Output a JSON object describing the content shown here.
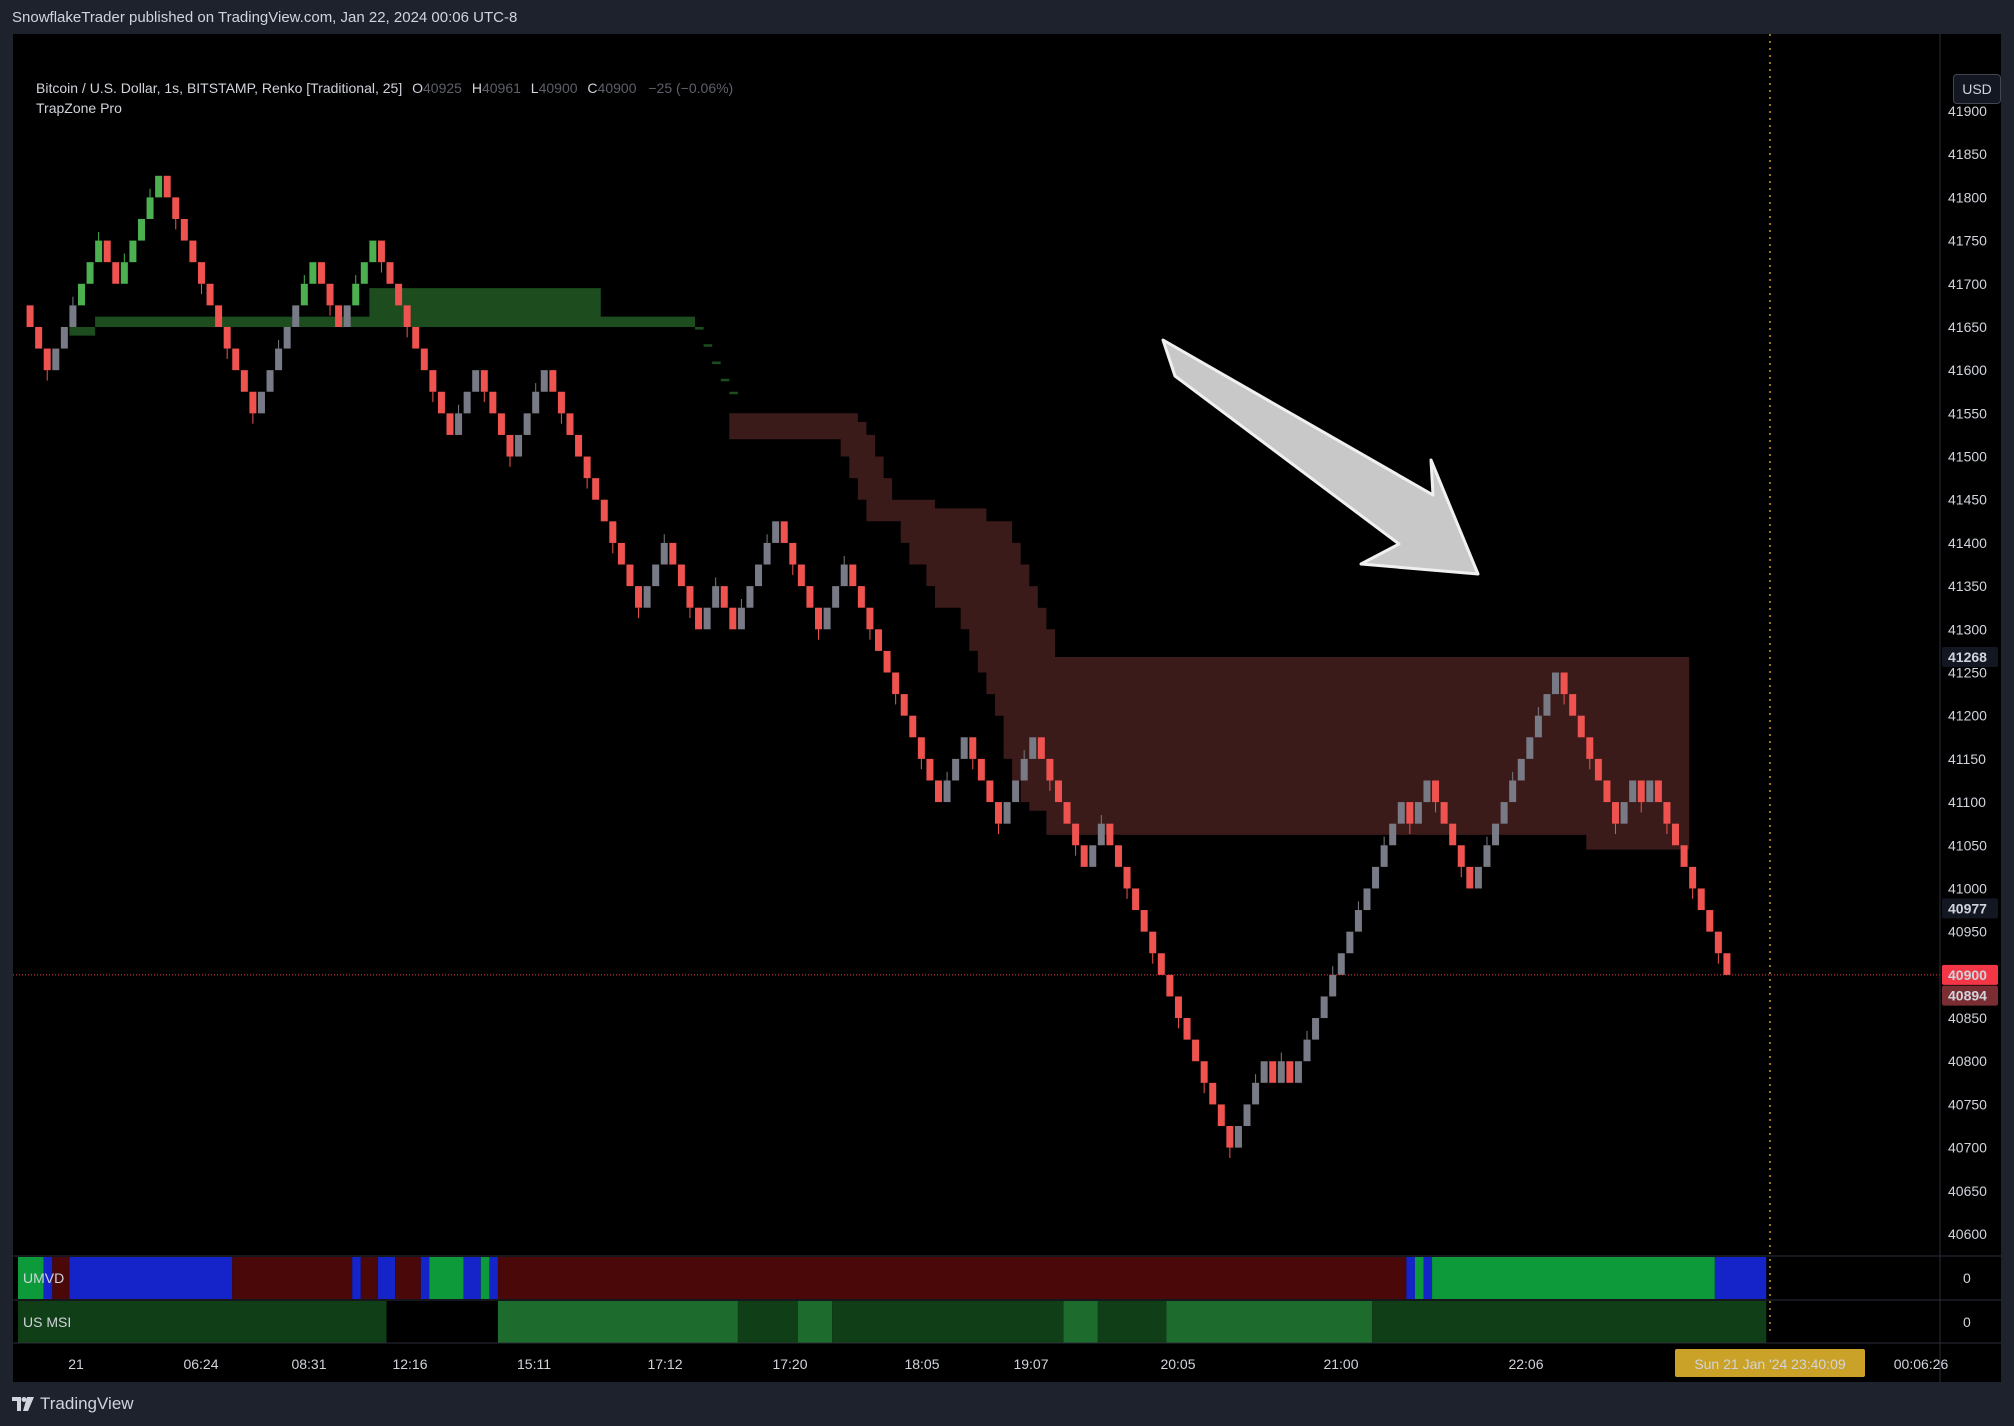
{
  "header": {
    "published": "SnowflakeTrader published on TradingView.com, Jan 22, 2024 00:06 UTC-8"
  },
  "legend": {
    "symbol": "Bitcoin / U.S. Dollar, 1s, BITSTAMP, Renko [Traditional, 25]",
    "o_label": "O",
    "o_value": "40925",
    "h_label": "H",
    "h_value": "40961",
    "l_label": "L",
    "l_value": "40900",
    "c_label": "C",
    "c_value": "40900",
    "change": "−25 (−0.06%)",
    "indicator": "TrapZone Pro"
  },
  "currency_button": "USD",
  "panels": {
    "umvd_label": "UMVD",
    "umvd_value": "0",
    "usmsi_label": "US MSI",
    "usmsi_value": "0"
  },
  "crosshair_time_label": "Sun 21 Jan '24   23:40:09",
  "footer": {
    "brand": "TradingView",
    "logo_icon": "tradingview-logo-icon"
  },
  "colors": {
    "bull": "#4caf50",
    "bear": "#ef5350",
    "neutral": "#787b86",
    "support_zone": "#1d4d1f",
    "resistance_zone": "#3b1a1a",
    "umvd_blue": "#1424c8",
    "umvd_red": "#4a0808",
    "umvd_green": "#0c9a3a",
    "msi_dark": "#103e16",
    "msi_light": "#1d6b2d",
    "last_price": "#f23645",
    "crosshair_price": "#7a2d33",
    "crosshair_time": "#c9a227"
  },
  "chart_data": {
    "type": "renko",
    "brick_size": 25,
    "ylim": [
      40600,
      41925
    ],
    "y_ticks": [
      40600,
      40650,
      40700,
      40750,
      40800,
      40850,
      40900,
      40950,
      41000,
      41050,
      41100,
      41150,
      41200,
      41250,
      41300,
      41350,
      41400,
      41450,
      41500,
      41550,
      41600,
      41650,
      41700,
      41750,
      41800,
      41850,
      41900
    ],
    "x_ticks": [
      "21",
      "06:24",
      "08:31",
      "12:16",
      "15:11",
      "17:12",
      "17:20",
      "18:05",
      "19:07",
      "20:05",
      "21:00",
      "22:06",
      "00:06:26"
    ],
    "price_labels": {
      "last": "40900",
      "crosshair": "40894",
      "zone_top": "41268",
      "zone_bottom": "40977"
    },
    "path": [
      41675,
      41650,
      41625,
      41600,
      41625,
      41650,
      41675,
      41700,
      41725,
      41750,
      41725,
      41700,
      41725,
      41750,
      41775,
      41800,
      41825,
      41800,
      41775,
      41750,
      41725,
      41700,
      41675,
      41650,
      41625,
      41600,
      41575,
      41550,
      41575,
      41600,
      41625,
      41650,
      41675,
      41700,
      41725,
      41700,
      41675,
      41650,
      41675,
      41700,
      41725,
      41750,
      41725,
      41700,
      41675,
      41650,
      41625,
      41600,
      41575,
      41550,
      41525,
      41550,
      41575,
      41600,
      41575,
      41550,
      41525,
      41500,
      41525,
      41550,
      41575,
      41600,
      41575,
      41550,
      41525,
      41500,
      41475,
      41450,
      41425,
      41400,
      41375,
      41350,
      41325,
      41350,
      41375,
      41400,
      41375,
      41350,
      41325,
      41300,
      41325,
      41350,
      41325,
      41300,
      41325,
      41350,
      41375,
      41400,
      41425,
      41400,
      41375,
      41350,
      41325,
      41300,
      41325,
      41350,
      41375,
      41350,
      41325,
      41300,
      41275,
      41250,
      41225,
      41200,
      41175,
      41150,
      41125,
      41100,
      41125,
      41150,
      41175,
      41150,
      41125,
      41100,
      41075,
      41100,
      41125,
      41150,
      41175,
      41150,
      41125,
      41100,
      41075,
      41050,
      41025,
      41050,
      41075,
      41050,
      41025,
      41000,
      40975,
      40950,
      40925,
      40900,
      40875,
      40850,
      40825,
      40800,
      40775,
      40750,
      40725,
      40700,
      40725,
      40750,
      40775,
      40800,
      40775,
      40800,
      40775,
      40800,
      40825,
      40850,
      40875,
      40900,
      40925,
      40950,
      40975,
      41000,
      41025,
      41050,
      41075,
      41100,
      41075,
      41100,
      41125,
      41100,
      41075,
      41050,
      41025,
      41000,
      41025,
      41050,
      41075,
      41100,
      41125,
      41150,
      41175,
      41200,
      41225,
      41250,
      41225,
      41200,
      41175,
      41150,
      41125,
      41100,
      41075,
      41100,
      41125,
      41100,
      41125,
      41100,
      41075,
      41050,
      41025,
      41000,
      40975,
      40950,
      40925,
      40900
    ],
    "support_zone": {
      "from_brick": 6,
      "to_brick": 83,
      "top": [
        41650,
        41650,
        41650,
        41662,
        41662,
        41662,
        41662,
        41662,
        41662,
        41662,
        41662,
        41662,
        41662,
        41662,
        41662,
        41662,
        41662,
        41662,
        41662,
        41662,
        41662,
        41662,
        41662,
        41662,
        41662,
        41662,
        41662,
        41662,
        41662,
        41662,
        41662,
        41662,
        41662,
        41662,
        41662,
        41695,
        41695,
        41695,
        41695,
        41695,
        41695,
        41695,
        41695,
        41695,
        41695,
        41695,
        41695,
        41695,
        41695,
        41695,
        41695,
        41695,
        41695,
        41695,
        41695,
        41695,
        41695,
        41695,
        41695,
        41695,
        41695,
        41695,
        41662,
        41662,
        41662,
        41662,
        41662,
        41662,
        41662,
        41662,
        41662,
        41662,
        41662,
        41650,
        41630,
        41610,
        41590,
        41575
      ],
      "bottom": [
        41640,
        41640,
        41640,
        41650,
        41650,
        41650,
        41650,
        41650,
        41650,
        41650,
        41650,
        41650,
        41650,
        41650,
        41650,
        41650,
        41650,
        41650,
        41650,
        41650,
        41650,
        41650,
        41650,
        41650,
        41650,
        41650,
        41650,
        41650,
        41650,
        41650,
        41650,
        41650,
        41650,
        41650,
        41650,
        41650,
        41650,
        41650,
        41650,
        41650,
        41650,
        41650,
        41650,
        41650,
        41650,
        41650,
        41650,
        41650,
        41650,
        41650,
        41650,
        41650,
        41650,
        41650,
        41650,
        41650,
        41650,
        41650,
        41650,
        41650,
        41650,
        41650,
        41650,
        41650,
        41650,
        41650,
        41650,
        41650,
        41650,
        41650,
        41650,
        41650,
        41650,
        41647,
        41627,
        41607,
        41587,
        41572
      ]
    },
    "resistance_zone": {
      "from_brick": 83,
      "to_brick": 194,
      "top": [
        41550,
        41550,
        41550,
        41550,
        41550,
        41550,
        41550,
        41550,
        41550,
        41550,
        41550,
        41550,
        41550,
        41550,
        41550,
        41540,
        41525,
        41500,
        41475,
        41450,
        41450,
        41450,
        41450,
        41450,
        41440,
        41440,
        41440,
        41440,
        41440,
        41440,
        41425,
        41425,
        41425,
        41400,
        41375,
        41350,
        41325,
        41300,
        41268,
        41268,
        41268,
        41268,
        41268,
        41268,
        41268,
        41268,
        41268,
        41268,
        41268,
        41268,
        41268,
        41268,
        41268,
        41268,
        41268,
        41268,
        41268,
        41268,
        41268,
        41268,
        41268,
        41268,
        41268,
        41268,
        41268,
        41268,
        41268,
        41268,
        41268,
        41268,
        41268,
        41268,
        41268,
        41268,
        41268,
        41268,
        41268,
        41268,
        41268,
        41268,
        41268,
        41268,
        41268,
        41268,
        41268,
        41268,
        41268,
        41268,
        41268,
        41268,
        41268,
        41268,
        41268,
        41268,
        41268,
        41268,
        41268,
        41268,
        41268,
        41268,
        41268,
        41268,
        41268,
        41268,
        41268,
        41268,
        41268,
        41268,
        41268,
        41268,
        41268,
        41268
      ],
      "bottom": [
        41520,
        41520,
        41520,
        41520,
        41520,
        41520,
        41520,
        41520,
        41520,
        41520,
        41520,
        41520,
        41520,
        41500,
        41475,
        41450,
        41425,
        41425,
        41425,
        41425,
        41400,
        41375,
        41375,
        41350,
        41325,
        41325,
        41325,
        41300,
        41275,
        41250,
        41225,
        41200,
        41150,
        41125,
        41100,
        41090,
        41090,
        41062,
        41062,
        41062,
        41062,
        41062,
        41062,
        41062,
        41062,
        41062,
        41062,
        41062,
        41062,
        41062,
        41062,
        41062,
        41062,
        41062,
        41062,
        41062,
        41062,
        41062,
        41062,
        41062,
        41062,
        41062,
        41062,
        41062,
        41062,
        41062,
        41062,
        41062,
        41062,
        41062,
        41062,
        41062,
        41062,
        41062,
        41062,
        41062,
        41062,
        41062,
        41062,
        41062,
        41062,
        41062,
        41062,
        41062,
        41062,
        41062,
        41062,
        41062,
        41062,
        41062,
        41062,
        41062,
        41062,
        41062,
        41062,
        41062,
        41062,
        41062,
        41062,
        41062,
        41045,
        41045,
        41045,
        41045,
        41045,
        41045,
        41045,
        41045,
        41045,
        41045,
        41045,
        41045
      ]
    },
    "umvd_segments": [
      {
        "from": 0,
        "to": 3,
        "c": "green"
      },
      {
        "from": 3,
        "to": 4,
        "c": "blue"
      },
      {
        "from": 4,
        "to": 6,
        "c": "red"
      },
      {
        "from": 6,
        "to": 25,
        "c": "blue"
      },
      {
        "from": 25,
        "to": 39,
        "c": "red"
      },
      {
        "from": 39,
        "to": 40,
        "c": "blue"
      },
      {
        "from": 40,
        "to": 42,
        "c": "red"
      },
      {
        "from": 42,
        "to": 44,
        "c": "blue"
      },
      {
        "from": 44,
        "to": 47,
        "c": "red"
      },
      {
        "from": 47,
        "to": 48,
        "c": "blue"
      },
      {
        "from": 48,
        "to": 52,
        "c": "green"
      },
      {
        "from": 52,
        "to": 54,
        "c": "blue"
      },
      {
        "from": 54,
        "to": 55,
        "c": "green"
      },
      {
        "from": 55,
        "to": 56,
        "c": "blue"
      },
      {
        "from": 56,
        "to": 162,
        "c": "red"
      },
      {
        "from": 162,
        "to": 163,
        "c": "blue"
      },
      {
        "from": 163,
        "to": 164,
        "c": "green"
      },
      {
        "from": 164,
        "to": 165,
        "c": "blue"
      },
      {
        "from": 165,
        "to": 198,
        "c": "green"
      },
      {
        "from": 198,
        "to": 204,
        "c": "blue"
      }
    ],
    "msi_segments": [
      {
        "from": 0,
        "to": 43,
        "c": "dark"
      },
      {
        "from": 56,
        "to": 84,
        "c": "light"
      },
      {
        "from": 84,
        "to": 91,
        "c": "dark"
      },
      {
        "from": 91,
        "to": 95,
        "c": "light"
      },
      {
        "from": 95,
        "to": 122,
        "c": "dark"
      },
      {
        "from": 122,
        "to": 126,
        "c": "light"
      },
      {
        "from": 126,
        "to": 134,
        "c": "dark"
      },
      {
        "from": 134,
        "to": 158,
        "c": "light"
      },
      {
        "from": 158,
        "to": 204,
        "c": "dark"
      }
    ]
  }
}
